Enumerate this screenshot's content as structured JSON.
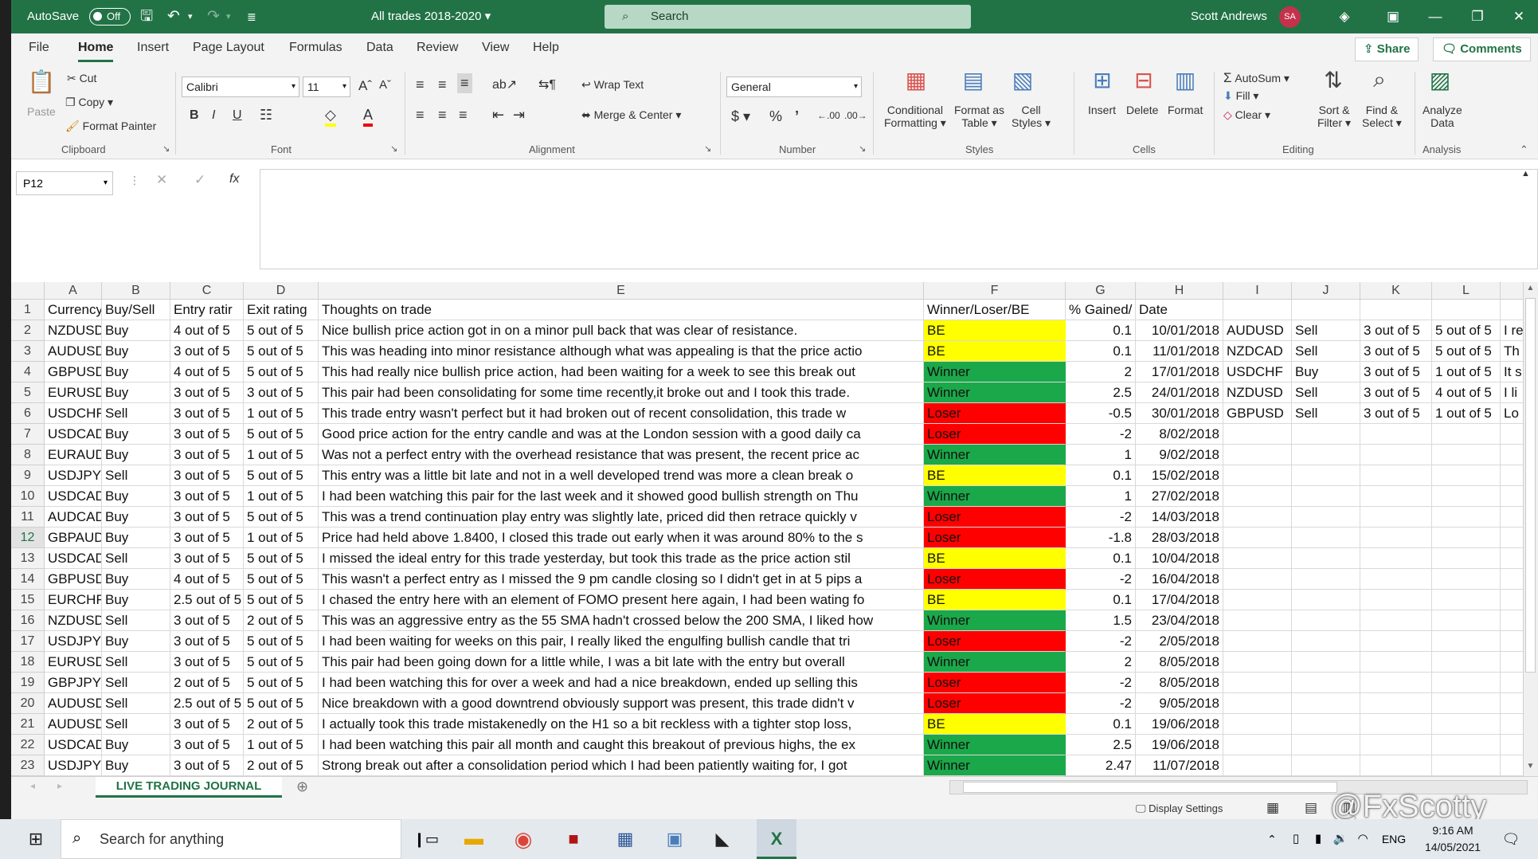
{
  "title_bar": {
    "autosave": "AutoSave",
    "autosave_state": "Off",
    "file_name": "All trades 2018-2020",
    "search_placeholder": "Search",
    "user_name": "Scott Andrews",
    "user_initials": "SA"
  },
  "menu_tabs": [
    "File",
    "Home",
    "Insert",
    "Page Layout",
    "Formulas",
    "Data",
    "Review",
    "View",
    "Help"
  ],
  "share_label": "Share",
  "comments_label": "Comments",
  "ribbon": {
    "clipboard": {
      "paste": "Paste",
      "cut": "Cut",
      "copy": "Copy",
      "format_painter": "Format Painter",
      "group": "Clipboard"
    },
    "font": {
      "font_name": "Calibri",
      "font_size": "11",
      "group": "Font"
    },
    "alignment": {
      "wrap_text": "Wrap Text",
      "merge_center": "Merge & Center",
      "group": "Alignment"
    },
    "number": {
      "format": "General",
      "group": "Number"
    },
    "styles": {
      "conditional": "Conditional",
      "formatting": "Formatting",
      "format_as": "Format as",
      "table": "Table",
      "cell": "Cell",
      "cell_styles": "Styles",
      "group": "Styles"
    },
    "cells": {
      "insert": "Insert",
      "delete": "Delete",
      "format": "Format",
      "group": "Cells"
    },
    "editing": {
      "autosum": "AutoSum",
      "fill": "Fill",
      "clear": "Clear",
      "sort": "Sort &",
      "filter": "Filter",
      "find": "Find &",
      "select": "Select",
      "group": "Editing"
    },
    "analysis": {
      "analyze": "Analyze",
      "data": "Data",
      "group": "Analysis"
    }
  },
  "name_box": "P12",
  "fx_label": "fx",
  "columns": [
    "A",
    "B",
    "C",
    "D",
    "E",
    "F",
    "G",
    "H",
    "I",
    "J",
    "K",
    "L"
  ],
  "header_row": [
    "Currency p",
    "Buy/Sell",
    "Entry ratir",
    "Exit rating",
    "Thoughts on trade",
    "Winner/Loser/BE",
    "% Gained/",
    "Date"
  ],
  "rows": [
    {
      "n": "2",
      "a": "NZDUSD",
      "b": "Buy",
      "c": "4 out of 5",
      "d": "5 out of 5",
      "e": "Nice bullish price action got in on a minor pull back that was clear of resistance.",
      "f": "BE",
      "g": "0.1",
      "h": "10/01/2018",
      "i": "AUDUSD",
      "j": "Sell",
      "k": "3 out of 5",
      "l": "5 out of 5",
      "m": "I re"
    },
    {
      "n": "3",
      "a": "AUDUSD",
      "b": "Buy",
      "c": "3 out of 5",
      "d": "5 out of 5",
      "e": "This was heading into minor resistance although what was appealing is that the price actio",
      "f": "BE",
      "g": "0.1",
      "h": "11/01/2018",
      "i": "NZDCAD",
      "j": "Sell",
      "k": "3 out of 5",
      "l": "5 out of 5",
      "m": "Th"
    },
    {
      "n": "4",
      "a": "GBPUSD",
      "b": "Buy",
      "c": "4 out of 5",
      "d": "5 out of 5",
      "e": "This had really nice bullish price action, had been waiting for a week to see this break out",
      "f": "Winner",
      "g": "2",
      "h": "17/01/2018",
      "i": "USDCHF",
      "j": "Buy",
      "k": "3 out of 5",
      "l": "1 out of 5",
      "m": "It s"
    },
    {
      "n": "5",
      "a": "EURUSD",
      "b": "Buy",
      "c": "3 out of 5",
      "d": "3 out of 5",
      "e": "This pair had been consolidating for some time recently,it broke out and I took this trade.",
      "f": "Winner",
      "g": "2.5",
      "h": "24/01/2018",
      "i": "NZDUSD",
      "j": "Sell",
      "k": "3 out of 5",
      "l": "4 out of 5",
      "m": "I li"
    },
    {
      "n": "6",
      "a": "USDCHF",
      "b": "Sell",
      "c": "3 out of 5",
      "d": "1 out of 5",
      "e": "This trade entry wasn't perfect but it had broken out of recent consolidation, this trade w",
      "f": "Loser",
      "g": "-0.5",
      "h": "30/01/2018",
      "i": "GBPUSD",
      "j": "Sell",
      "k": "3 out of 5",
      "l": "1 out of 5",
      "m": "Lo"
    },
    {
      "n": "7",
      "a": "USDCAD",
      "b": "Buy",
      "c": "3 out of 5",
      "d": "5 out of 5",
      "e": "Good price action for the entry candle and was at the London session with a good daily ca",
      "f": "Loser",
      "g": "-2",
      "h": "8/02/2018",
      "i": "",
      "j": "",
      "k": "",
      "l": "",
      "m": ""
    },
    {
      "n": "8",
      "a": "EURAUD",
      "b": "Buy",
      "c": "3 out of 5",
      "d": "1 out of 5",
      "e": "Was not a perfect entry with the overhead resistance that was present, the recent price ac",
      "f": "Winner",
      "g": "1",
      "h": "9/02/2018",
      "i": "",
      "j": "",
      "k": "",
      "l": "",
      "m": ""
    },
    {
      "n": "9",
      "a": "USDJPY",
      "b": "Sell",
      "c": "3 out of 5",
      "d": "5 out of 5",
      "e": "This entry was a little bit late and not in a well developed trend was more a clean break o",
      "f": "BE",
      "g": "0.1",
      "h": "15/02/2018",
      "i": "",
      "j": "",
      "k": "",
      "l": "",
      "m": ""
    },
    {
      "n": "10",
      "a": "USDCAD",
      "b": "Buy",
      "c": "3 out of 5",
      "d": "1 out of 5",
      "e": "I had been watching this pair for the last week and it showed good bullish strength on Thu",
      "f": "Winner",
      "g": "1",
      "h": "27/02/2018",
      "i": "",
      "j": "",
      "k": "",
      "l": "",
      "m": ""
    },
    {
      "n": "11",
      "a": "AUDCAD",
      "b": "Buy",
      "c": "3 out of 5",
      "d": "5 out of 5",
      "e": "This was a trend continuation play entry was slightly late, priced did then retrace quickly v",
      "f": "Loser",
      "g": "-2",
      "h": "14/03/2018",
      "i": "",
      "j": "",
      "k": "",
      "l": "",
      "m": ""
    },
    {
      "n": "12",
      "a": "GBPAUD",
      "b": "Buy",
      "c": "3 out of 5",
      "d": "1 out of 5",
      "e": "Price had held above 1.8400, I closed this trade out early when it was around 80% to the s",
      "f": "Loser",
      "g": "-1.8",
      "h": "28/03/2018",
      "i": "",
      "j": "",
      "k": "",
      "l": "",
      "m": ""
    },
    {
      "n": "13",
      "a": "USDCAD",
      "b": "Sell",
      "c": "3 out of 5",
      "d": "5 out of 5",
      "e": "I missed the ideal entry for this trade yesterday, but took this trade as the price action stil",
      "f": "BE",
      "g": "0.1",
      "h": "10/04/2018",
      "i": "",
      "j": "",
      "k": "",
      "l": "",
      "m": ""
    },
    {
      "n": "14",
      "a": "GBPUSD",
      "b": "Buy",
      "c": "4 out of 5",
      "d": "5 out of 5",
      "e": "This wasn't a perfect entry as I missed the 9 pm candle closing so I didn't get in at 5 pips a",
      "f": "Loser",
      "g": "-2",
      "h": "16/04/2018",
      "i": "",
      "j": "",
      "k": "",
      "l": "",
      "m": ""
    },
    {
      "n": "15",
      "a": "EURCHF",
      "b": "Buy",
      "c": "2.5 out of 5",
      "d": "5 out of 5",
      "e": "I chased the entry here with an element of FOMO present here again, I had been wating fo",
      "f": "BE",
      "g": "0.1",
      "h": "17/04/2018",
      "i": "",
      "j": "",
      "k": "",
      "l": "",
      "m": ""
    },
    {
      "n": "16",
      "a": "NZDUSD",
      "b": "Sell",
      "c": "3 out of 5",
      "d": "2 out of 5",
      "e": "This was an aggressive entry as the 55 SMA hadn't crossed below the 200 SMA, I liked how",
      "f": "Winner",
      "g": "1.5",
      "h": "23/04/2018",
      "i": "",
      "j": "",
      "k": "",
      "l": "",
      "m": ""
    },
    {
      "n": "17",
      "a": "USDJPY",
      "b": "Buy",
      "c": "3 out of 5",
      "d": "5 out of 5",
      "e": "I had been waiting for weeks on this pair, I really liked the engulfing bullish candle that tri",
      "f": "Loser",
      "g": "-2",
      "h": "2/05/2018",
      "i": "",
      "j": "",
      "k": "",
      "l": "",
      "m": ""
    },
    {
      "n": "18",
      "a": "EURUSD",
      "b": "Sell",
      "c": "3 out of 5",
      "d": "5 out of 5",
      "e": "This pair had been going down for a little while, I was a bit late with the entry but overall",
      "f": "Winner",
      "g": "2",
      "h": "8/05/2018",
      "i": "",
      "j": "",
      "k": "",
      "l": "",
      "m": ""
    },
    {
      "n": "19",
      "a": "GBPJPY",
      "b": "Sell",
      "c": "2 out of 5",
      "d": "5 out of 5",
      "e": "I had been watching this for over a week and had a nice breakdown, ended up selling this",
      "f": "Loser",
      "g": "-2",
      "h": "8/05/2018",
      "i": "",
      "j": "",
      "k": "",
      "l": "",
      "m": ""
    },
    {
      "n": "20",
      "a": "AUDUSD",
      "b": "Sell",
      "c": "2.5 out of 5",
      "d": "5 out of 5",
      "e": "Nice breakdown with a good downtrend obviously support was present, this trade didn't v",
      "f": "Loser",
      "g": "-2",
      "h": "9/05/2018",
      "i": "",
      "j": "",
      "k": "",
      "l": "",
      "m": ""
    },
    {
      "n": "21",
      "a": "AUDUSD",
      "b": "Sell",
      "c": "3 out of 5",
      "d": "2 out of 5",
      "e": "I actually took this trade mistakenedly on the H1 so a bit reckless with a tighter stop loss,",
      "f": "BE",
      "g": "0.1",
      "h": "19/06/2018",
      "i": "",
      "j": "",
      "k": "",
      "l": "",
      "m": ""
    },
    {
      "n": "22",
      "a": "USDCAD",
      "b": "Buy",
      "c": "3 out of 5",
      "d": "1 out of 5",
      "e": "I had been watching this pair all month and caught this breakout of previous highs, the ex",
      "f": "Winner",
      "g": "2.5",
      "h": "19/06/2018",
      "i": "",
      "j": "",
      "k": "",
      "l": "",
      "m": ""
    },
    {
      "n": "23",
      "a": "USDJPY",
      "b": "Buy",
      "c": "3 out of 5",
      "d": "2 out of 5",
      "e": "Strong break out after a consolidation period which I had been patiently waiting for, I got",
      "f": "Winner",
      "g": "2.47",
      "h": "11/07/2018",
      "i": "",
      "j": "",
      "k": "",
      "l": "",
      "m": ""
    }
  ],
  "result_colors": {
    "BE": "#ffff00",
    "Winner": "#1ba84a",
    "Loser": "#ff0000"
  },
  "sheet_tab": "LIVE TRADING JOURNAL",
  "status_bar": {
    "display_settings": "Display Settings"
  },
  "taskbar": {
    "search_placeholder": "Search for anything",
    "language": "ENG",
    "time": "9:16 AM",
    "date": "14/05/2021"
  },
  "watermark": "@FxScotty",
  "brand_color": "#217346"
}
